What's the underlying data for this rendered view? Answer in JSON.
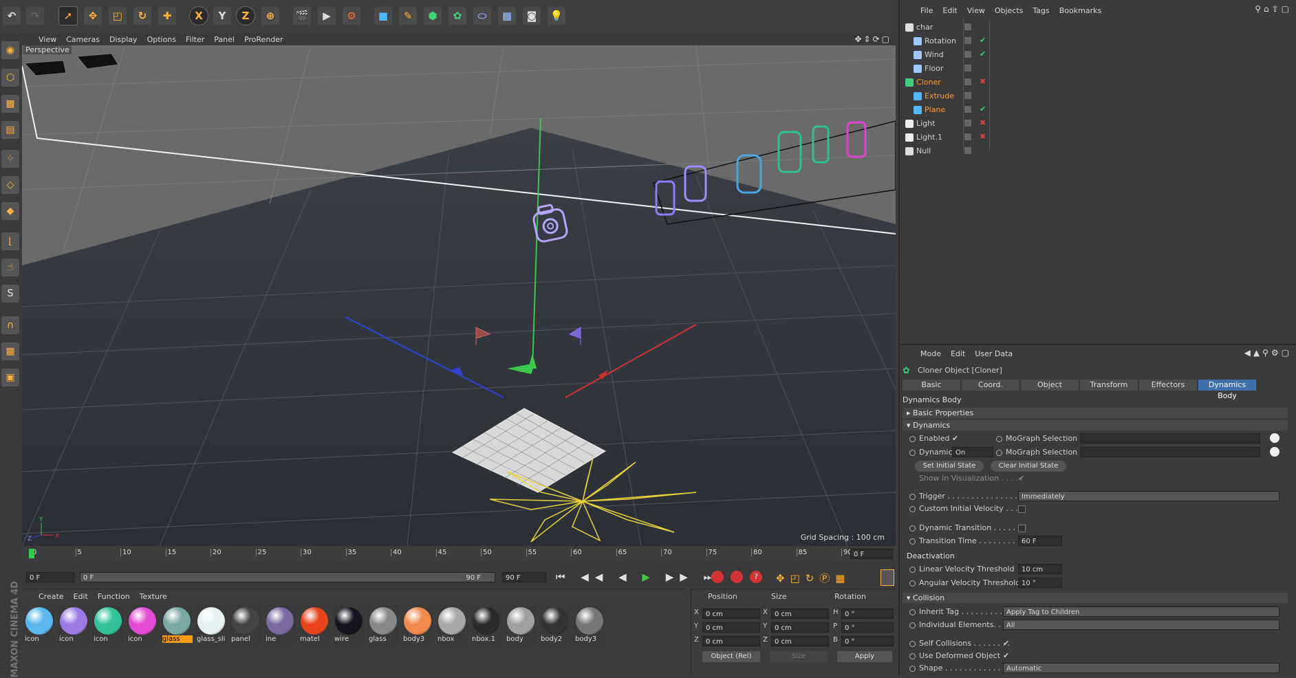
{
  "toolbar": {
    "undo_icon": "undo-icon",
    "axis_x": "X",
    "axis_y": "Y",
    "axis_z": "Z"
  },
  "viewport_menu": [
    "View",
    "Cameras",
    "Display",
    "Options",
    "Filter",
    "Panel",
    "ProRender"
  ],
  "viewport": {
    "label": "Perspective",
    "grid_spacing": "Grid Spacing : 100 cm"
  },
  "timeline": {
    "ticks": [
      "0",
      "5",
      "10",
      "15",
      "20",
      "25",
      "30",
      "35",
      "40",
      "45",
      "50",
      "55",
      "60",
      "65",
      "70",
      "75",
      "80",
      "85",
      "90"
    ],
    "current_frame": "0 F",
    "start_field": "0 F",
    "range_start": "0 F",
    "range_end": "90 F",
    "end_field": "90 F"
  },
  "object_manager": {
    "menu": [
      "File",
      "Edit",
      "View",
      "Objects",
      "Tags",
      "Bookmarks"
    ],
    "objects": [
      {
        "name": "char",
        "color": "#d0d0d0",
        "status": "none"
      },
      {
        "name": "Rotation",
        "color": "#d0d0d0",
        "status": "check"
      },
      {
        "name": "Wind",
        "color": "#d0d0d0",
        "status": "check"
      },
      {
        "name": "Floor",
        "color": "#d0d0d0",
        "status": "none"
      },
      {
        "name": "Cloner",
        "color": "#ff9c2a",
        "status": "cross"
      },
      {
        "name": "Extrude",
        "color": "#ff9c2a",
        "status": "none"
      },
      {
        "name": "Plane",
        "color": "#ff9c2a",
        "status": "check"
      },
      {
        "name": "Light",
        "color": "#d0d0d0",
        "status": "cross"
      },
      {
        "name": "Light.1",
        "color": "#d0d0d0",
        "status": "cross"
      },
      {
        "name": "Null",
        "color": "#d0d0d0",
        "status": "none"
      }
    ]
  },
  "attributes": {
    "menu": [
      "Mode",
      "Edit",
      "User Data"
    ],
    "object_title": "Cloner Object [Cloner]",
    "tabs": [
      "Basic",
      "Coord.",
      "Object",
      "Transform",
      "Effectors",
      "Dynamics Body"
    ],
    "active_tab": "Dynamics Body",
    "heading": "Dynamics Body",
    "basic_properties": "Basic Properties",
    "dynamics_section": "Dynamics",
    "enabled_label": "Enabled",
    "dynamic_label": "Dynamic",
    "dynamic_value": "On",
    "mograph_selection_1": "MoGraph Selection",
    "mograph_selection_2": "MoGraph Selection",
    "set_initial_state": "Set Initial State",
    "clear_initial_state": "Clear Initial State",
    "show_in_visualization": "Show in Visualization . . . . .",
    "trigger_label": "Trigger . . . . . . . . . . . . . . .",
    "trigger_value": "Immediately",
    "custom_initial_velocity": "Custom Initial Velocity . . . .",
    "dynamic_transition": "Dynamic Transition . . . . . . .",
    "transition_time_label": "Transition Time . . . . . . . . . .",
    "transition_time_value": "60 F",
    "deactivation": "Deactivation",
    "linear_velocity_label": "Linear Velocity Threshold",
    "linear_velocity_value": "10 cm",
    "angular_velocity_label": "Angular Velocity Threshold",
    "angular_velocity_value": "10 °",
    "collision_section": "Collision",
    "inherit_tag_label": "Inherit Tag . . . . . . . . . . . .",
    "inherit_tag_value": "Apply Tag to Children",
    "individual_elements_label": "Individual Elements. . .",
    "individual_elements_value": "All",
    "self_collisions_label": "Self Collisions . . . . . . . .",
    "use_deformed_label": "Use Deformed Object",
    "shape_label": "Shape . . . . . . . . . . . . . . .",
    "shape_value": "Automatic"
  },
  "material_manager": {
    "menu": [
      "Create",
      "Edit",
      "Function",
      "Texture"
    ],
    "materials": [
      {
        "name": "icon",
        "color": "#5bb8ef"
      },
      {
        "name": "icon",
        "color": "#9b7be6"
      },
      {
        "name": "icon",
        "color": "#34c29a"
      },
      {
        "name": "icon",
        "color": "#e24bd5"
      },
      {
        "name": "glass",
        "color": "#7aa8a4"
      },
      {
        "name": "glass_sli",
        "color": "#e6f2f2"
      },
      {
        "name": "panel",
        "color": "#444444"
      },
      {
        "name": "ine",
        "color": "#7a6aa0"
      },
      {
        "name": "matel",
        "color": "#e9431c"
      },
      {
        "name": "wire",
        "color": "#15151f"
      },
      {
        "name": "glass",
        "color": "#888888"
      },
      {
        "name": "body3",
        "color": "#f08a4c"
      },
      {
        "name": "nbox",
        "color": "#a8a8a8"
      },
      {
        "name": "nbox.1",
        "color": "#2a2a2a"
      },
      {
        "name": "body",
        "color": "#a0a0a0"
      },
      {
        "name": "body2",
        "color": "#333333"
      },
      {
        "name": "body3",
        "color": "#777777"
      }
    ],
    "selected_index": 4
  },
  "coordinates": {
    "headers": [
      "Position",
      "Size",
      "Rotation"
    ],
    "rows": [
      {
        "axis": "X",
        "pos": "0 cm",
        "size_axis": "X",
        "size": "0 cm",
        "rot_axis": "H",
        "rot": "0 °"
      },
      {
        "axis": "Y",
        "pos": "0 cm",
        "size_axis": "Y",
        "size": "0 cm",
        "rot_axis": "P",
        "rot": "0 °"
      },
      {
        "axis": "Z",
        "pos": "0 cm",
        "size_axis": "Z",
        "size": "0 cm",
        "rot_axis": "B",
        "rot": "0 °"
      }
    ],
    "mode_select": "Object (Rel)",
    "size_select": "Size",
    "apply": "Apply"
  },
  "brand": "MAXON CINEMA 4D"
}
